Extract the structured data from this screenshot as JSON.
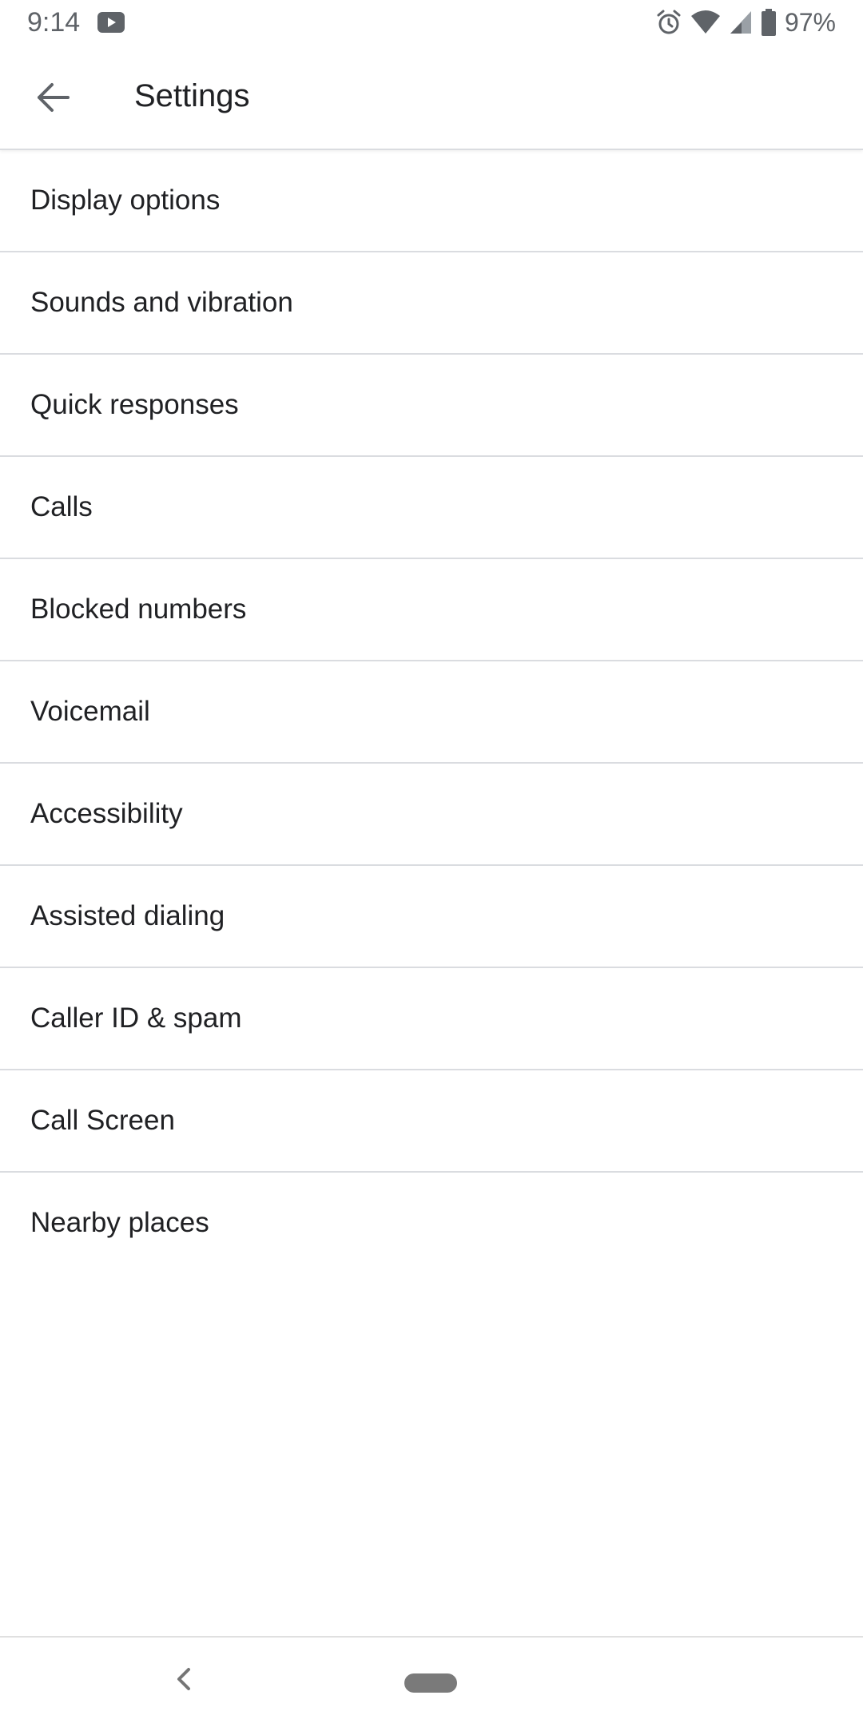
{
  "status_bar": {
    "time": "9:14",
    "battery_percent": "97%",
    "icons": [
      "youtube-icon",
      "alarm-icon",
      "wifi-icon",
      "cell-signal-icon",
      "battery-icon"
    ]
  },
  "app_bar": {
    "title": "Settings",
    "back_icon": "arrow-back-icon"
  },
  "settings": {
    "items": [
      {
        "label": "Display options"
      },
      {
        "label": "Sounds and vibration"
      },
      {
        "label": "Quick responses"
      },
      {
        "label": "Calls"
      },
      {
        "label": "Blocked numbers"
      },
      {
        "label": "Voicemail"
      },
      {
        "label": "Accessibility"
      },
      {
        "label": "Assisted dialing"
      },
      {
        "label": "Caller ID & spam"
      },
      {
        "label": "Call Screen"
      },
      {
        "label": "Nearby places"
      }
    ]
  },
  "nav_bar": {
    "back_icon": "nav-back-icon",
    "home_icon": "home-pill-icon"
  },
  "colors": {
    "text_primary": "#202124",
    "text_secondary": "#5f6368",
    "divider": "#dadce0",
    "background": "#ffffff"
  }
}
